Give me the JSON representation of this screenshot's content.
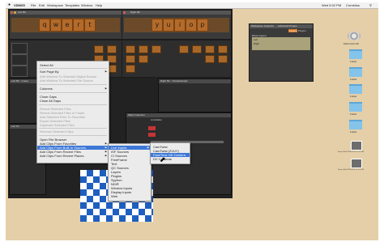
{
  "menubar": {
    "apple_glyph": "",
    "app_name": "VDMX5",
    "items": [
      "File",
      "Edit",
      "Workspace",
      "Templates",
      "Window",
      "Help"
    ],
    "status": "Wed 5:02 PM",
    "user": "Cornelius"
  },
  "windows": {
    "left6_title": "Left 6th",
    "right6_title": "Right 6th",
    "left_linear_title": "Left 5th : Linear",
    "left_fx_title": "Left FX",
    "right_checker_title": "Right 5th : Checkerboard",
    "workspace_title": "Workspace Inspector",
    "workspace_tab2": "Advanced Project",
    "workspace_tabs": [
      "Layers",
      "Plugins"
    ],
    "workspace_header": "Mixed Layers",
    "workspace_rows": [
      "Left",
      "Right"
    ],
    "slider_inspector": "Slider Inspector",
    "slider_title": "crossfader"
  },
  "keys_left": [
    "q",
    "w",
    "e",
    "r",
    "t"
  ],
  "keys_right": [
    "y",
    "u",
    "i",
    "o",
    "p"
  ],
  "context_menu": {
    "items": [
      {
        "label": "Select All",
        "disabled": false,
        "arrow": false
      },
      {
        "label": "Sort Page By",
        "disabled": false,
        "arrow": true
      },
      {
        "label": "Add Window To Selected Digital Source",
        "disabled": true,
        "arrow": false
      },
      {
        "label": "Add Window To Selected File Source",
        "disabled": true,
        "arrow": false
      },
      {
        "label": "Columns",
        "disabled": false,
        "arrow": true
      },
      {
        "label": "Close Gaps",
        "disabled": false,
        "arrow": false
      },
      {
        "label": "Close All Gaps",
        "disabled": false,
        "arrow": false
      },
      {
        "label": "Reveal Selected Files",
        "disabled": true,
        "arrow": false
      },
      {
        "label": "Reveal Selected Files In Finder",
        "disabled": true,
        "arrow": false
      },
      {
        "label": "Add Selected Files To Favorites",
        "disabled": true,
        "arrow": false
      },
      {
        "label": "Export Selected Files",
        "disabled": true,
        "arrow": false
      },
      {
        "label": "Duplicate Selected Files",
        "disabled": true,
        "arrow": false
      },
      {
        "label": "Remove Selected Clips",
        "disabled": true,
        "arrow": false
      },
      {
        "label": "Open File Browser",
        "disabled": false,
        "arrow": false
      },
      {
        "label": "Add Clips From Favorites",
        "disabled": false,
        "arrow": true
      },
      {
        "label": "Add Clips From Built-In Sources",
        "disabled": false,
        "arrow": true,
        "selected": true
      },
      {
        "label": "Add Clips From Recent Files",
        "disabled": false,
        "arrow": true
      },
      {
        "label": "Add Clips From Recent Places",
        "disabled": false,
        "arrow": true
      }
    ]
  },
  "submenu1": {
    "items": [
      {
        "label": "Live Inputs",
        "selected": true
      },
      {
        "label": "ISF Sources"
      },
      {
        "label": "CI Sources"
      },
      {
        "label": "FreeFrame"
      },
      {
        "label": "Text"
      },
      {
        "label": "QC Sources"
      },
      {
        "label": "Layers"
      },
      {
        "label": "Plugins"
      },
      {
        "label": "Syphon"
      },
      {
        "label": "NDI®"
      },
      {
        "label": "Window Inputs"
      },
      {
        "label": "Display Inputs"
      },
      {
        "label": "Web"
      }
    ]
  },
  "submenu2": {
    "items": [
      {
        "label": "CamTwist"
      },
      {
        "label": "CamTwist (2VUY)"
      },
      {
        "label": "FaceTime HD Camera",
        "selected": true
      },
      {
        "label": "DV Cameras"
      }
    ]
  },
  "desktop": {
    "items": [
      {
        "label": "Macintosh HD",
        "icon": "hard-drive-icon"
      },
      {
        "label": "Folder",
        "icon": "folder-icon"
      },
      {
        "label": "Folder",
        "icon": "folder-icon"
      },
      {
        "label": "Folder",
        "icon": "folder-icon"
      },
      {
        "label": "Folder",
        "icon": "folder-icon"
      },
      {
        "label": "Folder",
        "icon": "folder-icon"
      },
      {
        "label": "Screen Shot 2019-04-15 at 5.01 PM",
        "icon": "screenshot-file-icon"
      },
      {
        "label": "Screen Shot 2019-04-15 at 5.02 PM",
        "icon": "screenshot-file-icon"
      }
    ]
  },
  "colors": {
    "accent": "#3d78d8",
    "key": "#b36a2a",
    "desktop": "#e4cfa8"
  }
}
